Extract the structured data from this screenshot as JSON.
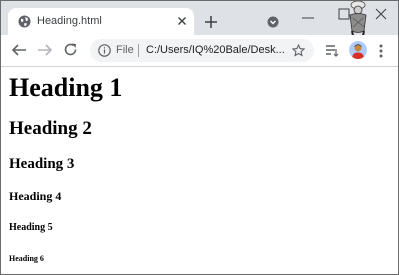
{
  "browser": {
    "tab": {
      "title": "Heading.html",
      "favicon": "globe-icon",
      "close": "close-icon"
    },
    "new_tab": "plus-icon",
    "tab_search": "tab-search-icon",
    "window_controls": [
      "minimize-icon",
      "maximize-icon",
      "close-icon"
    ],
    "nav": [
      "back-arrow-icon",
      "forward-arrow-icon",
      "reload-icon"
    ],
    "omnibox": {
      "security_icon": "info-icon",
      "scheme": "File",
      "url": "C:/Users/IQ%20Bale/Desk...",
      "bookmark": "star-icon"
    },
    "toolbar_right": [
      "reading-list-icon",
      "profile-avatar",
      "menu-dots-icon"
    ]
  },
  "page": {
    "h1": "Heading 1",
    "h2": "Heading 2",
    "h3": "Heading 3",
    "h4": "Heading 4",
    "h5": "Heading 5",
    "h6": "Heading 6"
  },
  "colors": {
    "tabstrip": "#dee1e6",
    "omnibox": "#f1f3f4",
    "icon": "#5f6368"
  }
}
